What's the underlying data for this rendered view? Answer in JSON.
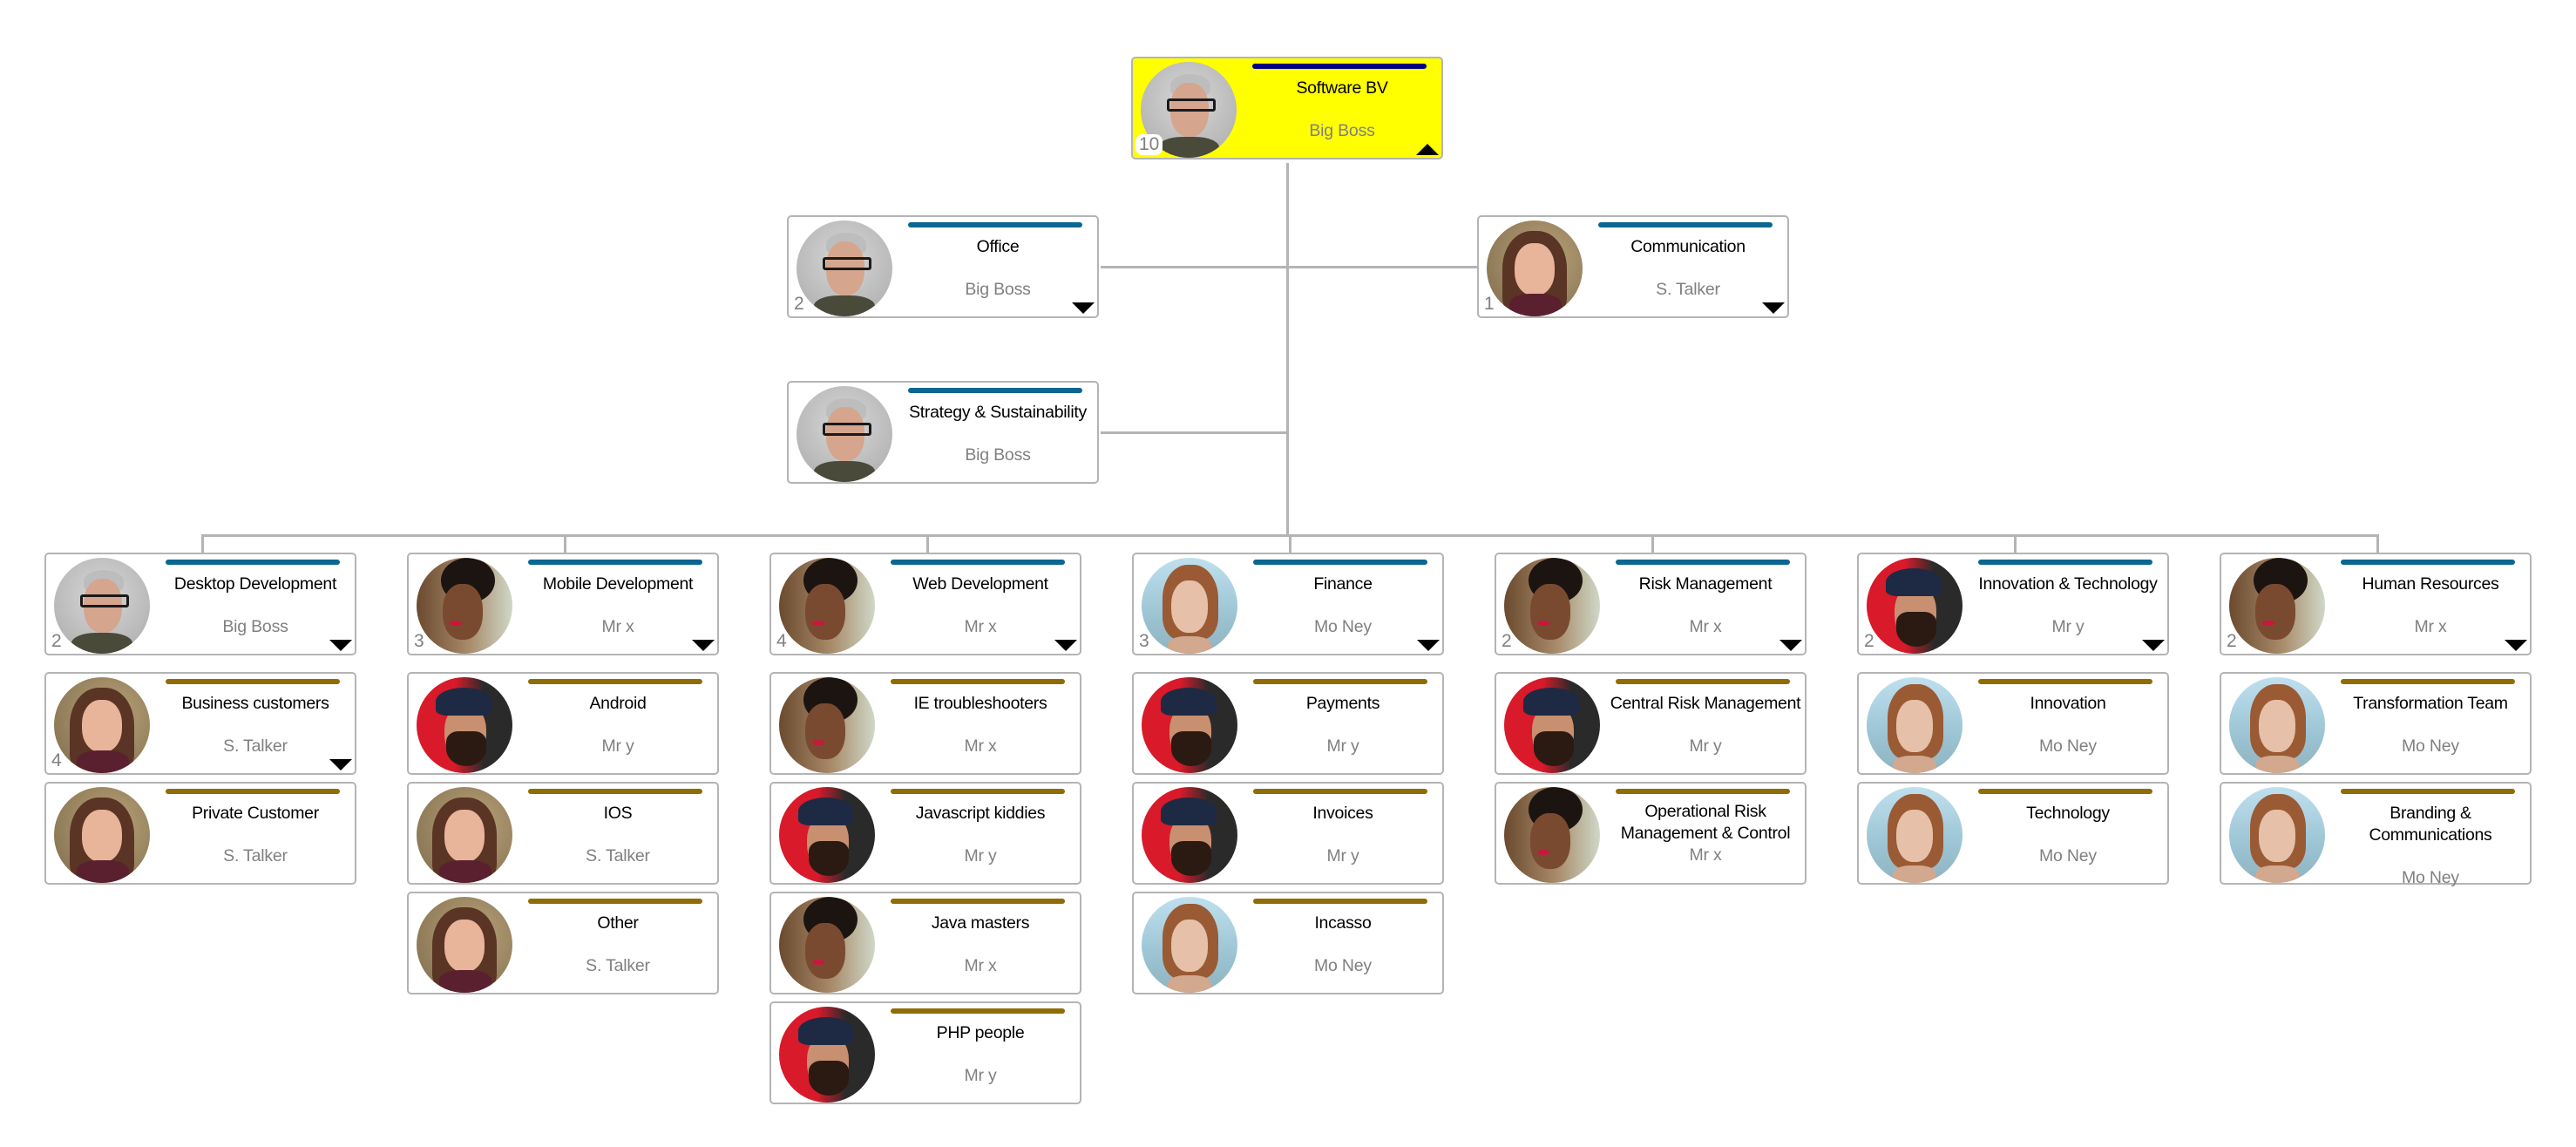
{
  "colors": {
    "root_fill": "#ffff00",
    "department_bar": "#0b6690",
    "team_bar": "#8f6c05",
    "root_bar": "#000080",
    "connector": "#b4b4b4",
    "title_text": "#000000",
    "subtitle_text": "#808080"
  },
  "root": {
    "title": "Software BV",
    "subtitle": "Big Boss",
    "count": "10",
    "avatar": "big-boss",
    "toggle": "collapse"
  },
  "side_nodes": [
    {
      "title": "Office",
      "subtitle": "Big Boss",
      "count": "2",
      "avatar": "big-boss",
      "toggle": "expand"
    },
    {
      "title": "Communication",
      "subtitle": "S. Talker",
      "count": "1",
      "avatar": "s-talker",
      "toggle": "expand"
    },
    {
      "title": "Strategy & Sustainability",
      "subtitle": "Big Boss",
      "count": "",
      "avatar": "big-boss",
      "toggle": ""
    }
  ],
  "departments": [
    {
      "title": "Desktop Development",
      "subtitle": "Big Boss",
      "count": "2",
      "avatar": "big-boss",
      "toggle": "expand",
      "teams": [
        {
          "title": "Business customers",
          "subtitle": "S. Talker",
          "count": "4",
          "avatar": "s-talker",
          "toggle": "expand"
        },
        {
          "title": "Private Customer",
          "subtitle": "S. Talker",
          "count": "",
          "avatar": "s-talker",
          "toggle": ""
        }
      ]
    },
    {
      "title": "Mobile Development",
      "subtitle": "Mr x",
      "count": "3",
      "avatar": "mr-x",
      "toggle": "expand",
      "teams": [
        {
          "title": "Android",
          "subtitle": "Mr y",
          "count": "",
          "avatar": "mr-y",
          "toggle": ""
        },
        {
          "title": "IOS",
          "subtitle": "S. Talker",
          "count": "",
          "avatar": "s-talker",
          "toggle": ""
        },
        {
          "title": "Other",
          "subtitle": "S. Talker",
          "count": "",
          "avatar": "s-talker",
          "toggle": ""
        }
      ]
    },
    {
      "title": "Web Development",
      "subtitle": "Mr x",
      "count": "4",
      "avatar": "mr-x",
      "toggle": "expand",
      "teams": [
        {
          "title": "IE troubleshooters",
          "subtitle": "Mr x",
          "count": "",
          "avatar": "mr-x",
          "toggle": ""
        },
        {
          "title": "Javascript kiddies",
          "subtitle": "Mr y",
          "count": "",
          "avatar": "mr-y",
          "toggle": ""
        },
        {
          "title": "Java masters",
          "subtitle": "Mr x",
          "count": "",
          "avatar": "mr-x",
          "toggle": ""
        },
        {
          "title": "PHP people",
          "subtitle": "Mr y",
          "count": "",
          "avatar": "mr-y",
          "toggle": ""
        }
      ]
    },
    {
      "title": "Finance",
      "subtitle": "Mo Ney",
      "count": "3",
      "avatar": "mo-ney",
      "toggle": "expand",
      "teams": [
        {
          "title": "Payments",
          "subtitle": "Mr y",
          "count": "",
          "avatar": "mr-y",
          "toggle": ""
        },
        {
          "title": "Invoices",
          "subtitle": "Mr y",
          "count": "",
          "avatar": "mr-y",
          "toggle": ""
        },
        {
          "title": "Incasso",
          "subtitle": "Mo Ney",
          "count": "",
          "avatar": "mo-ney",
          "toggle": ""
        }
      ]
    },
    {
      "title": "Risk Management",
      "subtitle": "Mr x",
      "count": "2",
      "avatar": "mr-x",
      "toggle": "expand",
      "teams": [
        {
          "title": "Central Risk Management",
          "subtitle": "Mr y",
          "count": "",
          "avatar": "mr-y",
          "toggle": ""
        },
        {
          "title": "Operational Risk Management & Control",
          "subtitle": "Mr x",
          "count": "",
          "avatar": "mr-x",
          "toggle": ""
        }
      ]
    },
    {
      "title": "Innovation & Technology",
      "subtitle": "Mr y",
      "count": "2",
      "avatar": "mr-y",
      "toggle": "expand",
      "teams": [
        {
          "title": "Innovation",
          "subtitle": "Mo Ney",
          "count": "",
          "avatar": "mo-ney",
          "toggle": ""
        },
        {
          "title": "Technology",
          "subtitle": "Mo Ney",
          "count": "",
          "avatar": "mo-ney",
          "toggle": ""
        }
      ]
    },
    {
      "title": "Human Resources",
      "subtitle": "Mr x",
      "count": "2",
      "avatar": "mr-x",
      "toggle": "expand",
      "teams": [
        {
          "title": "Transformation Team",
          "subtitle": "Mo Ney",
          "count": "",
          "avatar": "mo-ney",
          "toggle": ""
        },
        {
          "title": "Branding & Communications",
          "subtitle": "Mo Ney",
          "count": "",
          "avatar": "mo-ney",
          "toggle": ""
        }
      ]
    }
  ]
}
